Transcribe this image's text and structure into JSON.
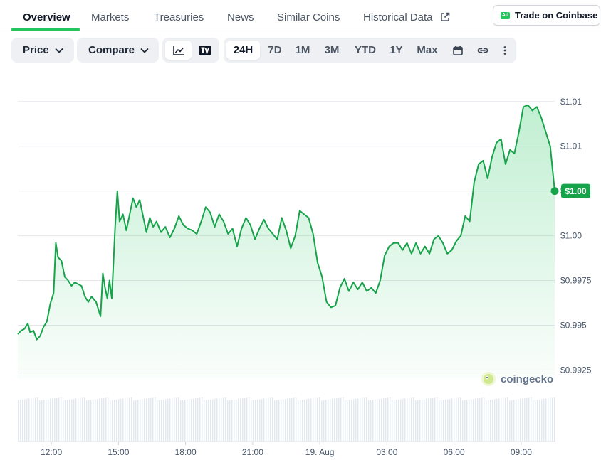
{
  "tabs": [
    {
      "label": "Overview",
      "active": true
    },
    {
      "label": "Markets"
    },
    {
      "label": "Treasuries"
    },
    {
      "label": "News"
    },
    {
      "label": "Similar Coins"
    },
    {
      "label": "Historical Data"
    }
  ],
  "trade_button": {
    "ad_badge": "Ad",
    "label": "Trade on Coinbase"
  },
  "toolbar": {
    "price_dropdown": "Price",
    "compare_dropdown": "Compare",
    "chart_modes": [
      "line-chart-icon",
      "tradingview-icon"
    ],
    "ranges": [
      "24H",
      "7D",
      "1M",
      "3M",
      "YTD",
      "1Y",
      "Max"
    ],
    "selected_range": "24H",
    "icons": [
      "calendar-icon",
      "link-icon",
      "more-vertical-icon"
    ]
  },
  "colors": {
    "accent": "#22c55e",
    "line": "#16a34a",
    "tag": "#16a34a"
  },
  "watermark": "coingecko",
  "chart_data": {
    "type": "area",
    "title": "",
    "xlabel": "",
    "ylabel": "",
    "y_tick_labels": [
      "$1.01",
      "$1.01",
      "$1.00",
      "$1.00",
      "$0.9975",
      "$0.995",
      "$0.9925"
    ],
    "y_tick_values": [
      1.0075,
      1.005,
      1.0025,
      1.0,
      0.9975,
      0.995,
      0.9925
    ],
    "ylim": [
      0.992,
      1.0092
    ],
    "x_tick_labels": [
      "12:00",
      "15:00",
      "18:00",
      "21:00",
      "19. Aug",
      "03:00",
      "06:00",
      "09:00"
    ],
    "x_tick_hours": [
      1.5,
      4.5,
      7.5,
      10.5,
      13.5,
      16.5,
      19.5,
      22.5
    ],
    "xlim": [
      0,
      24
    ],
    "current_price_label": "$1.00",
    "current_price": 1.0025,
    "grid": true,
    "series": [
      {
        "values": [
          [
            0.0,
            0.9945
          ],
          [
            0.15,
            0.9947
          ],
          [
            0.3,
            0.9948
          ],
          [
            0.45,
            0.9951
          ],
          [
            0.55,
            0.9946
          ],
          [
            0.7,
            0.9947
          ],
          [
            0.85,
            0.9942
          ],
          [
            1.0,
            0.9944
          ],
          [
            1.15,
            0.9949
          ],
          [
            1.3,
            0.9952
          ],
          [
            1.45,
            0.9962
          ],
          [
            1.6,
            0.9968
          ],
          [
            1.7,
            0.9996
          ],
          [
            1.8,
            0.9988
          ],
          [
            1.95,
            0.9986
          ],
          [
            2.1,
            0.9977
          ],
          [
            2.25,
            0.9975
          ],
          [
            2.4,
            0.9972
          ],
          [
            2.55,
            0.9974
          ],
          [
            2.7,
            0.9973
          ],
          [
            2.85,
            0.9972
          ],
          [
            3.0,
            0.9966
          ],
          [
            3.15,
            0.9963
          ],
          [
            3.3,
            0.9966
          ],
          [
            3.5,
            0.9963
          ],
          [
            3.7,
            0.9955
          ],
          [
            3.8,
            0.9979
          ],
          [
            3.9,
            0.9971
          ],
          [
            4.0,
            0.9965
          ],
          [
            4.1,
            0.9975
          ],
          [
            4.2,
            0.9965
          ],
          [
            4.35,
            1.0005
          ],
          [
            4.45,
            1.0025
          ],
          [
            4.55,
            1.0008
          ],
          [
            4.7,
            1.0012
          ],
          [
            4.85,
            1.0003
          ],
          [
            5.0,
            1.0012
          ],
          [
            5.15,
            1.0021
          ],
          [
            5.3,
            1.0016
          ],
          [
            5.45,
            1.002
          ],
          [
            5.6,
            1.0011
          ],
          [
            5.75,
            1.0002
          ],
          [
            5.9,
            1.001
          ],
          [
            6.05,
            1.0005
          ],
          [
            6.2,
            1.0008
          ],
          [
            6.4,
            1.0002
          ],
          [
            6.6,
            1.0005
          ],
          [
            6.8,
            0.9999
          ],
          [
            7.0,
            1.0004
          ],
          [
            7.2,
            1.0011
          ],
          [
            7.4,
            1.0006
          ],
          [
            7.6,
            1.0004
          ],
          [
            7.8,
            1.0003
          ],
          [
            8.0,
            1.0001
          ],
          [
            8.2,
            1.0008
          ],
          [
            8.4,
            1.0016
          ],
          [
            8.6,
            1.0013
          ],
          [
            8.8,
            1.0005
          ],
          [
            9.0,
            1.0012
          ],
          [
            9.2,
            1.0008
          ],
          [
            9.4,
            1.0001
          ],
          [
            9.6,
            1.0004
          ],
          [
            9.8,
            0.9994
          ],
          [
            10.0,
            1.0004
          ],
          [
            10.2,
            1.001
          ],
          [
            10.4,
            1.0006
          ],
          [
            10.6,
            0.9998
          ],
          [
            10.8,
            1.0004
          ],
          [
            11.0,
            1.0009
          ],
          [
            11.2,
            1.0004
          ],
          [
            11.4,
            1.0001
          ],
          [
            11.6,
            0.9998
          ],
          [
            11.8,
            1.001
          ],
          [
            12.0,
            1.0003
          ],
          [
            12.2,
            0.9993
          ],
          [
            12.4,
            1.0
          ],
          [
            12.6,
            1.0014
          ],
          [
            12.8,
            1.0012
          ],
          [
            13.0,
            1.001
          ],
          [
            13.2,
            1.0001
          ],
          [
            13.4,
            0.9985
          ],
          [
            13.6,
            0.9977
          ],
          [
            13.8,
            0.9963
          ],
          [
            14.0,
            0.996
          ],
          [
            14.2,
            0.9961
          ],
          [
            14.4,
            0.9971
          ],
          [
            14.6,
            0.9976
          ],
          [
            14.8,
            0.9969
          ],
          [
            15.0,
            0.9974
          ],
          [
            15.2,
            0.997
          ],
          [
            15.4,
            0.9974
          ],
          [
            15.6,
            0.9969
          ],
          [
            15.8,
            0.9971
          ],
          [
            16.0,
            0.9968
          ],
          [
            16.2,
            0.9975
          ],
          [
            16.4,
            0.9989
          ],
          [
            16.6,
            0.9994
          ],
          [
            16.8,
            0.9996
          ],
          [
            17.0,
            0.9996
          ],
          [
            17.2,
            0.9992
          ],
          [
            17.4,
            0.9996
          ],
          [
            17.6,
            0.999
          ],
          [
            17.8,
            0.9996
          ],
          [
            18.0,
            0.999
          ],
          [
            18.2,
            0.9994
          ],
          [
            18.4,
            0.999
          ],
          [
            18.6,
            0.9998
          ],
          [
            18.8,
            1.0
          ],
          [
            19.0,
            0.9996
          ],
          [
            19.2,
            0.999
          ],
          [
            19.4,
            0.9992
          ],
          [
            19.6,
            0.9997
          ],
          [
            19.8,
            1.0
          ],
          [
            20.0,
            1.0011
          ],
          [
            20.2,
            1.0008
          ],
          [
            20.4,
            1.003
          ],
          [
            20.6,
            1.004
          ],
          [
            20.8,
            1.0042
          ],
          [
            21.0,
            1.0032
          ],
          [
            21.2,
            1.0044
          ],
          [
            21.4,
            1.0052
          ],
          [
            21.6,
            1.0054
          ],
          [
            21.8,
            1.004
          ],
          [
            22.0,
            1.0048
          ],
          [
            22.2,
            1.0046
          ],
          [
            22.4,
            1.0058
          ],
          [
            22.6,
            1.0072
          ],
          [
            22.8,
            1.0073
          ],
          [
            23.0,
            1.007
          ],
          [
            23.2,
            1.0072
          ],
          [
            23.4,
            1.0066
          ],
          [
            23.6,
            1.0058
          ],
          [
            23.8,
            1.005
          ],
          [
            24.0,
            1.0025
          ]
        ]
      }
    ]
  }
}
